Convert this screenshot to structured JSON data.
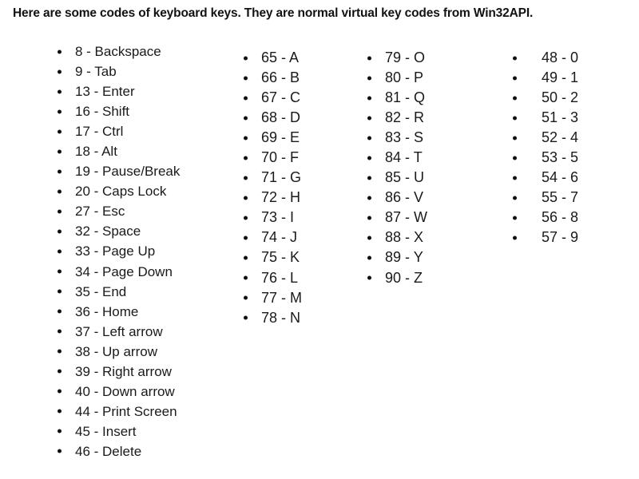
{
  "page": {
    "title": "Here are some codes of keyboard keys. They are normal virtual key codes from Win32API.",
    "background_color": "#ffffff",
    "text_color": "#1a1a1a",
    "bullet_color": "#111111"
  },
  "columns": [
    {
      "name": "control-and-navigation-keys",
      "items": [
        "8 - Backspace",
        "9 - Tab",
        "13 - Enter",
        "16 - Shift",
        "17 - Ctrl",
        "18 - Alt",
        "19 - Pause/Break",
        "20 - Caps Lock",
        "27 - Esc",
        "32 - Space",
        "33 - Page Up",
        "34 - Page Down",
        "35 - End",
        "36 - Home",
        "37 - Left arrow",
        "38 - Up arrow",
        "39 - Right arrow",
        "40 - Down arrow",
        "44 - Print Screen",
        "45 - Insert",
        "46 - Delete"
      ]
    },
    {
      "name": "letter-keys-a-to-n",
      "items": [
        "65 - A",
        "66 - B",
        "67 - C",
        "68 - D",
        "69 - E",
        "70 - F",
        "71 - G",
        "72 - H",
        "73 - I",
        "74 - J",
        "75 - K",
        "76 - L",
        "77 - M",
        "78 - N"
      ]
    },
    {
      "name": "letter-keys-o-to-z",
      "items": [
        "79 - O",
        "80 - P",
        "81 - Q",
        "82 - R",
        "83 - S",
        "84 - T",
        "85 - U",
        "86 - V",
        "87 - W",
        "88 - X",
        "89 - Y",
        "90 - Z"
      ]
    },
    {
      "name": "digit-keys-0-to-9",
      "items": [
        "48 - 0",
        "49 - 1",
        "50 - 2",
        "51 - 3",
        "52 - 4",
        "53 - 5",
        "54 - 6",
        "55 - 7",
        "56 - 8",
        "57 - 9"
      ]
    }
  ]
}
